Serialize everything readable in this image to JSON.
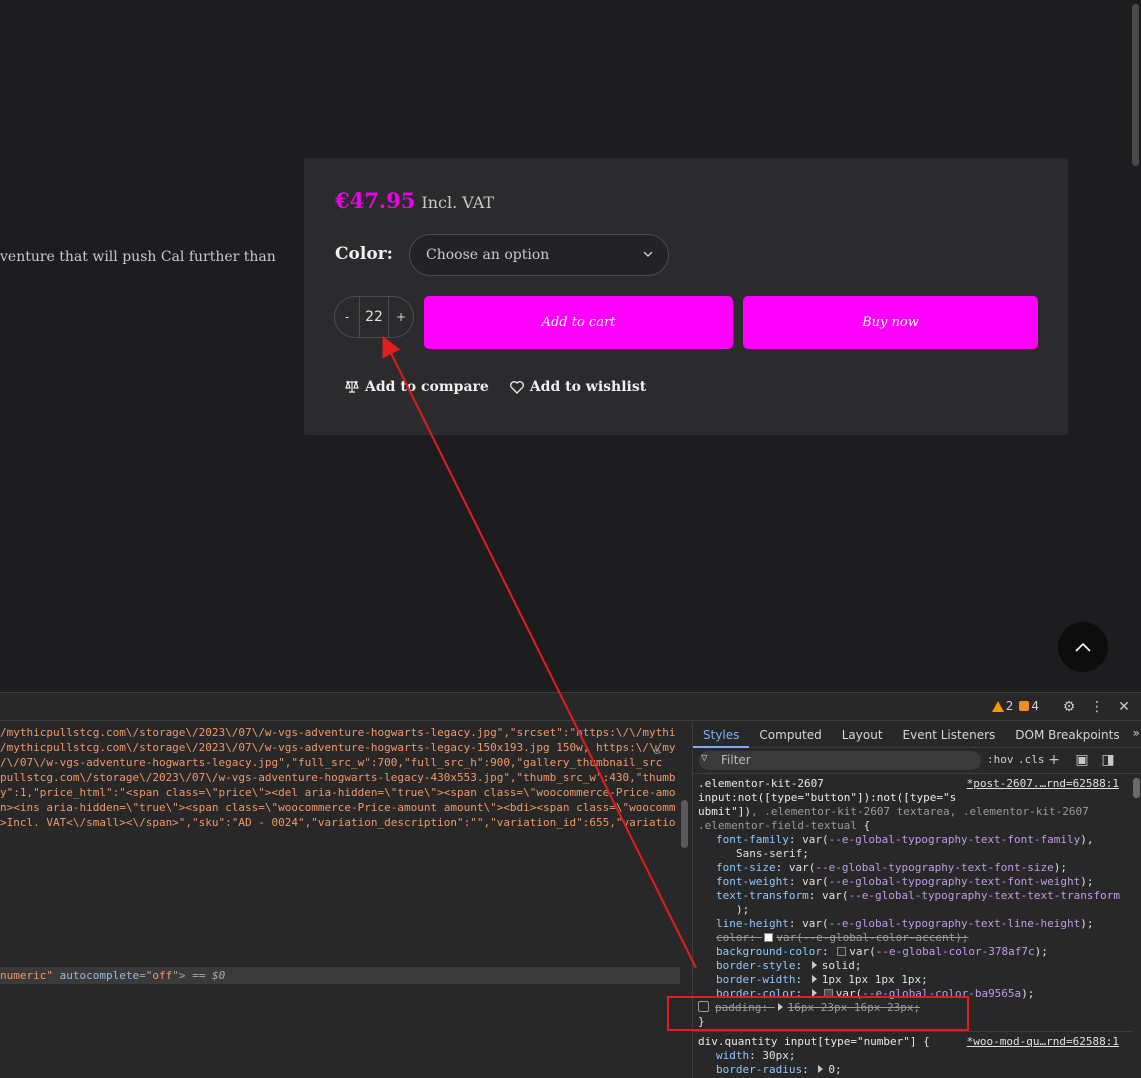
{
  "page": {
    "description_fragment": "venture that will push Cal further than",
    "price": "€47.95",
    "vat_label": "Incl. VAT",
    "color_label": "Color:",
    "color_select": "Choose an option",
    "qty_minus": "-",
    "qty_value": "22",
    "qty_plus": "+",
    "add_to_cart": "Add to cart",
    "buy_now": "Buy now",
    "compare_label": "Add to compare",
    "wishlist_label": "Add to wishlist",
    "accent_color": "#ff00ff"
  },
  "devtools": {
    "warning_count": "2",
    "issue_count": "4",
    "source_lines": [
      "/mythicpullstcg.com\\/storage\\/2023\\/07\\/w-vgs-adventure-hogwarts-legacy.jpg\",\"srcset\":\"https:\\/\\/mythi",
      "/mythicpullstcg.com\\/storage\\/2023\\/07\\/w-vgs-adventure-hogwarts-legacy-150x193.jpg 150w, https:\\/\\/mythi",
      "/\\/07\\/w-vgs-adventure-hogwarts-legacy.jpg\",\"full_src_w\":700,\"full_src_h\":900,\"gallery_thumbnail_src",
      "pullstcg.com\\/storage\\/2023\\/07\\/w-vgs-adventure-hogwarts-legacy-430x553.jpg\",\"thumb_src_w\":430,\"thumb",
      "y\":1,\"price_html\":\"<span class=\\\"price\\\"><del aria-hidden=\\\"true\\\"><span class=\\\"woocommerce-Price-amo",
      "n><ins aria-hidden=\\\"true\\\"><span class=\\\"woocommerce-Price-amount amount\\\"><bdi><span class=\\\"woocomm",
      ">Incl. VAT<\\/small><\\/span>\",\"sku\":\"AD - 0024\",\"variation_description\":\"\",\"variation_id\":655,\"variatio"
    ],
    "selected": {
      "attr_tail": "numeric\"",
      "attr_name": "autocomplete",
      "attr_eq": "=\"",
      "attr_value": "off",
      "close": "\">",
      "eq": "==",
      "var": "$0"
    },
    "tabs": [
      "Styles",
      "Computed",
      "Layout",
      "Event Listeners",
      "DOM Breakpoints"
    ],
    "filter_placeholder": "Filter",
    "hov": ":hov",
    "cls": ".cls",
    "rules": {
      "r1_sel1": ".elementor-kit-2607",
      "r1_sel2": "input:not([type=\"button\"]):not([type=\"s",
      "r1_sel3a": "ubmit\"])",
      "r1_sel3b": ", .elementor-kit-2607 textarea, .elementor-kit-2607",
      "r1_sel4": ".elementor-field-textual",
      "r1_open": "{",
      "r1_source": "*post-2607.…rnd=62588:1",
      "p_font_family": "font-family",
      "v_font_family_a": "var(",
      "v_font_family_var": "--e-global-typography-text-font-family",
      "v_font_family_b": "),",
      "v_font_family_c": "Sans-serif;",
      "p_font_size": "font-size",
      "v_font_size_var": "--e-global-typography-text-font-size",
      "p_font_weight": "font-weight",
      "v_font_weight_var": "--e-global-typography-text-font-weight",
      "p_text_transform": "text-transform",
      "v_text_transform_var": "--e-global-typography-text-text-transform",
      "v_text_transform_end": ");",
      "p_line_height": "line-height",
      "v_line_height_var": "--e-global-typography-text-line-height",
      "p_color": "color",
      "v_color_var": "--e-global-color-accent",
      "p_bg": "background-color",
      "v_bg_var": "--e-global-color-378af7c",
      "p_border_style": "border-style",
      "v_border_style": "solid;",
      "p_border_width": "border-width",
      "v_border_width": "1px 1px 1px 1px;",
      "p_border_color": "border-color",
      "v_border_color_var": "--e-global-color-ba9565a",
      "p_padding": "padding",
      "v_padding": "16px 23px 16px 23px;",
      "r1_close": "}",
      "r2_sel": "div.quantity input[type=\"number\"]",
      "r2_open": "{",
      "r2_source": "*woo-mod-qu…rnd=62588:1",
      "p_width": "width",
      "v_width": "30px;",
      "p_border_radius": "border-radius",
      "v_border_radius": "0;"
    }
  }
}
